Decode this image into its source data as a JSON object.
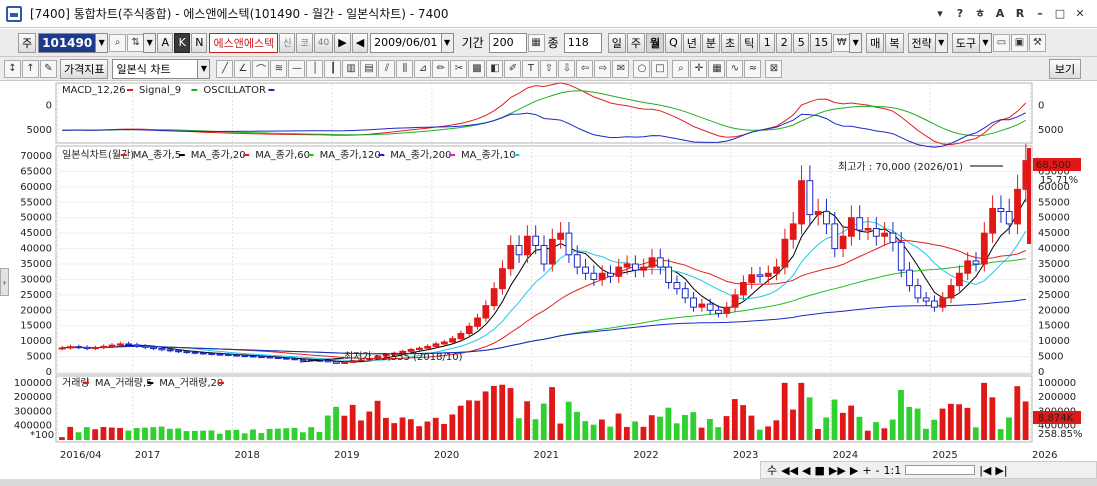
{
  "window": {
    "title": "[7400]  통합차트(주식종합) - 에스앤에스텍(101490 - 월간 - 일본식차트) - 7400",
    "controls": [
      "▾",
      "?",
      "ㅎ",
      "A",
      "R",
      "–",
      "□",
      "✕"
    ]
  },
  "toolbar1": {
    "type_label": "주",
    "code": "101490",
    "name": "에스앤에스텍",
    "tags": [
      "신",
      "코",
      "40"
    ],
    "date": "2009/06/01",
    "period_label": "기간",
    "period_value": "200",
    "count_label": "종",
    "count_value": "118",
    "interval_buttons": [
      "일",
      "주",
      "월",
      "Q",
      "년",
      "분",
      "초",
      "틱",
      "1",
      "2",
      "5",
      "15"
    ],
    "selected_interval": "월",
    "right_buttons": [
      "매",
      "복",
      "전략",
      "도구"
    ]
  },
  "toolbar2": {
    "indicator_button": "가격지표",
    "chart_type": "일본식 차트",
    "view_button": "보기"
  },
  "chart": {
    "macd_legend": [
      {
        "label": "MACD_12,26",
        "color": "#e02020"
      },
      {
        "label": "Signal_9",
        "color": "#20b020"
      },
      {
        "label": "OSCILLATOR",
        "color": "#1c28c8"
      }
    ],
    "macd_ticks": [
      "5000",
      "0"
    ],
    "price_legend": [
      {
        "label": "일본식차트(월간)",
        "color": "#e02020"
      },
      {
        "label": "MA_종가,5",
        "color": "#000000"
      },
      {
        "label": "MA_종가,20",
        "color": "#e02020"
      },
      {
        "label": "MA_종가,60",
        "color": "#20c020"
      },
      {
        "label": "MA_종가,120",
        "color": "#1c28c8"
      },
      {
        "label": "MA_종가,200",
        "color": "#e020e0"
      },
      {
        "label": "MA_종가,10",
        "color": "#20c8e8"
      }
    ],
    "price_ticks": [
      "70000",
      "65000",
      "60000",
      "55000",
      "50000",
      "45000",
      "40000",
      "35000",
      "30000",
      "25000",
      "20000",
      "15000",
      "10000",
      "5000",
      "0"
    ],
    "price_ticks_right": [
      "65000",
      "60000",
      "55000",
      "50000",
      "45000",
      "40000",
      "35000",
      "30000",
      "25000",
      "20000",
      "15000",
      "10000",
      "5000",
      "0"
    ],
    "current_price": "68,500",
    "change_pct": "15.71%",
    "high_annotation": "최고가 : 70,000 (2026/01)",
    "low_annotation": "최저가 : 2,555 (2018/10)",
    "volume_legend": [
      {
        "label": "거래량",
        "color": "#e02020"
      },
      {
        "label": "MA_거래량,5",
        "color": "#000000"
      },
      {
        "label": "MA_거래량,20",
        "color": "#e02020"
      }
    ],
    "volume_ticks": [
      "400000",
      "300000",
      "200000",
      "100000"
    ],
    "volume_scale": "*100",
    "volume_current": "8,874K",
    "volume_pct": "258.85%",
    "x_labels": [
      "2016/04",
      "2017",
      "2018",
      "2019",
      "2020",
      "2021",
      "2022",
      "2023",
      "2024",
      "2025",
      "2026"
    ]
  },
  "navbar": {
    "items": [
      "수",
      "◀◀",
      "◀",
      "■",
      "▶▶",
      "▶",
      "+",
      "-",
      "1:1",
      "|◀",
      "▶|"
    ]
  },
  "chart_data": {
    "type": "candlestick",
    "title": "에스앤에스텍(101490 - 월간 - 일본식차트)",
    "series_price": {
      "start": "2016/04",
      "interval": "month",
      "close": [
        7800,
        8200,
        8000,
        7600,
        7900,
        8300,
        8700,
        9100,
        8800,
        8400,
        8000,
        7600,
        7200,
        6900,
        6600,
        6400,
        6200,
        6000,
        5800,
        5700,
        5500,
        5300,
        5200,
        5000,
        4900,
        4700,
        4500,
        4300,
        4100,
        4000,
        3800,
        3700,
        3300,
        2800,
        3100,
        3600,
        3900,
        4400,
        5200,
        5700,
        6100,
        6700,
        7300,
        7700,
        8300,
        9100,
        9700,
        10800,
        12500,
        14800,
        17500,
        21500,
        27000,
        33500,
        41000,
        38000,
        44000,
        41000,
        35000,
        43000,
        45000,
        38000,
        34000,
        32000,
        30000,
        32000,
        31000,
        34000,
        35000,
        33000,
        34000,
        37000,
        34000,
        29000,
        27000,
        24000,
        21000,
        22000,
        20000,
        19000,
        21000,
        25000,
        29000,
        31500,
        31000,
        32000,
        34000,
        43000,
        48000,
        62000,
        51000,
        52000,
        48000,
        40000,
        44000,
        50000,
        46000,
        46500,
        44000,
        45000,
        42000,
        33000,
        28000,
        24000,
        23000,
        21000,
        24000,
        28000,
        32000,
        36000,
        35000,
        45000,
        53000,
        52000,
        48000,
        59200,
        68500
      ],
      "annotations": {
        "high": "70,000 (2026/01)",
        "low": "2,555 (2018/10)"
      }
    },
    "macd": {
      "ylim": [
        -2000,
        9000
      ],
      "ticks": [
        0,
        5000
      ]
    },
    "volume": {
      "ticks": [
        100000,
        200000,
        300000,
        400000
      ],
      "scale": "*100"
    },
    "ylim": [
      0,
      70000
    ]
  }
}
